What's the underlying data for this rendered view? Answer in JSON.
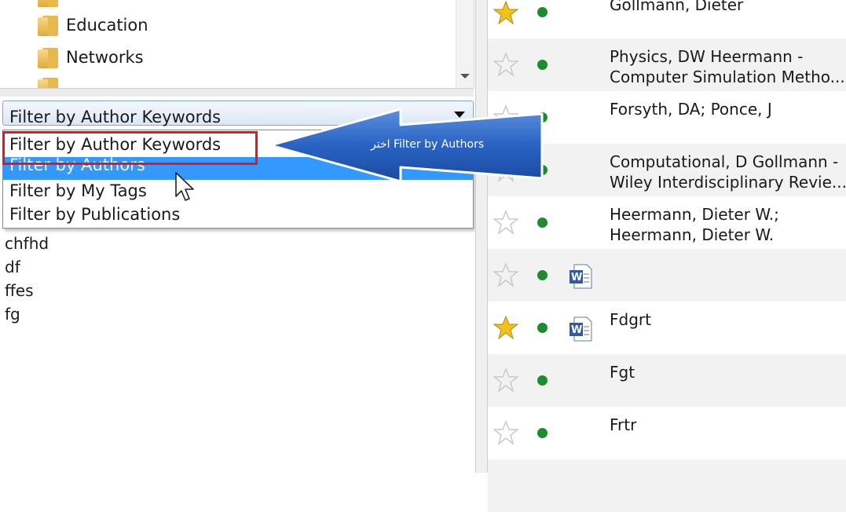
{
  "folder_tree": {
    "items": [
      {
        "label": "Education",
        "icon": "folder-icon"
      },
      {
        "label": "Networks",
        "icon": "folder-icon"
      }
    ]
  },
  "filter": {
    "selected_label": "Filter by Author Keywords",
    "options": [
      {
        "label": "Filter by Author Keywords",
        "selected": false
      },
      {
        "label": "Filter by Authors",
        "selected": true
      },
      {
        "label": "Filter by My Tags",
        "selected": false
      },
      {
        "label": "Filter by Publications",
        "selected": false
      }
    ]
  },
  "keywords": [
    "chfhd",
    "df",
    "ffes",
    "fg"
  ],
  "callout": {
    "text": "اختر Filter by Authors",
    "highlight_color": "#e0191e",
    "arrow_color": "#1f5fbf"
  },
  "documents": [
    {
      "favorite": true,
      "status": "read",
      "has_file": false,
      "lines": [
        "Gollmann, Dieter"
      ]
    },
    {
      "favorite": false,
      "status": "read",
      "has_file": false,
      "lines": [
        "Physics, DW Heermann -",
        "Computer Simulation Metho..."
      ]
    },
    {
      "favorite": false,
      "status": "read",
      "has_file": false,
      "lines": [
        "Forsyth, DA; Ponce, J"
      ]
    },
    {
      "favorite": false,
      "status": "read",
      "has_file": false,
      "lines": [
        "Computational, D Gollmann -",
        "Wiley Interdisciplinary Revie..."
      ]
    },
    {
      "favorite": false,
      "status": "read",
      "has_file": false,
      "lines": [
        "Heermann, Dieter W.;",
        "Heermann, Dieter W."
      ]
    },
    {
      "favorite": false,
      "status": "read",
      "has_file": true,
      "lines": [
        ""
      ]
    },
    {
      "favorite": true,
      "status": "read",
      "has_file": true,
      "lines": [
        "Fdgrt"
      ]
    },
    {
      "favorite": false,
      "status": "read",
      "has_file": false,
      "lines": [
        "Fgt"
      ]
    },
    {
      "favorite": false,
      "status": "read",
      "has_file": false,
      "lines": [
        "Frtr"
      ]
    }
  ],
  "colors": {
    "selection": "#3399ff",
    "status_dot": "#1e8c2e",
    "star_filled": "#f2c21b"
  }
}
